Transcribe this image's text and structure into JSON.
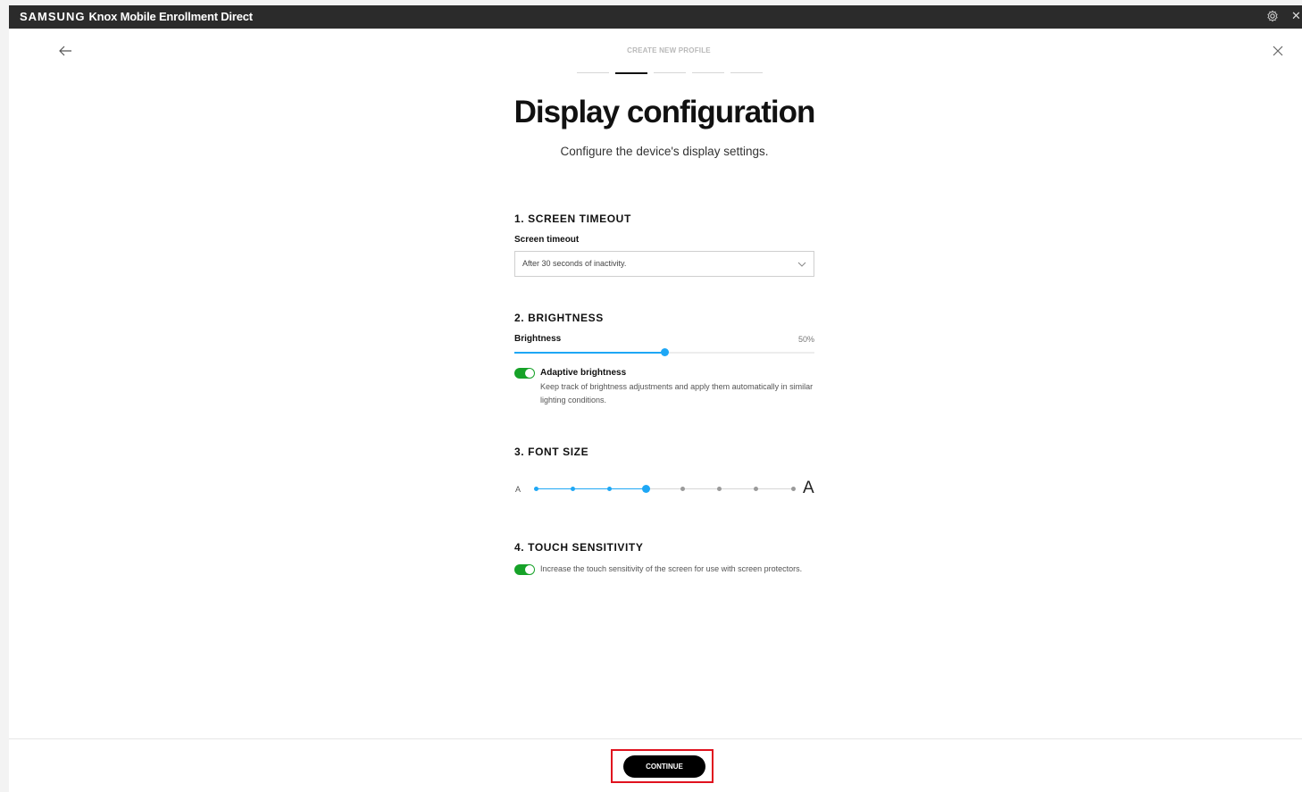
{
  "app": {
    "brand": "SAMSUNG",
    "title": "Knox Mobile Enrollment Direct"
  },
  "wizard": {
    "step_label": "CREATE NEW PROFILE",
    "total_steps": 5,
    "current_step": 2,
    "heading": "Display configuration",
    "subheading": "Configure the device's display settings."
  },
  "screen_timeout": {
    "section_title": "1. SCREEN TIMEOUT",
    "field_label": "Screen timeout",
    "selected_value": "After 30 seconds of inactivity."
  },
  "brightness": {
    "section_title": "2. BRIGHTNESS",
    "field_label": "Brightness",
    "value_text": "50%",
    "value_fraction": 0.5,
    "adaptive_title": "Adaptive brightness",
    "adaptive_desc": "Keep track of brightness adjustments and apply them automatically in similar lighting conditions.",
    "adaptive_on": true
  },
  "font_size": {
    "section_title": "3. FONT SIZE",
    "small_label": "A",
    "large_label": "A",
    "levels": 8,
    "selected_level": 4
  },
  "touch_sensitivity": {
    "section_title": "4. TOUCH SENSITIVITY",
    "desc": "Increase the touch sensitivity of the screen for use with screen protectors.",
    "enabled": true
  },
  "footer": {
    "continue_label": "CONTINUE"
  },
  "colors": {
    "accent": "#1ea7f5",
    "toggle_on": "#16a228",
    "highlight": "#e0121e",
    "titlebar": "#2b2b2b"
  }
}
